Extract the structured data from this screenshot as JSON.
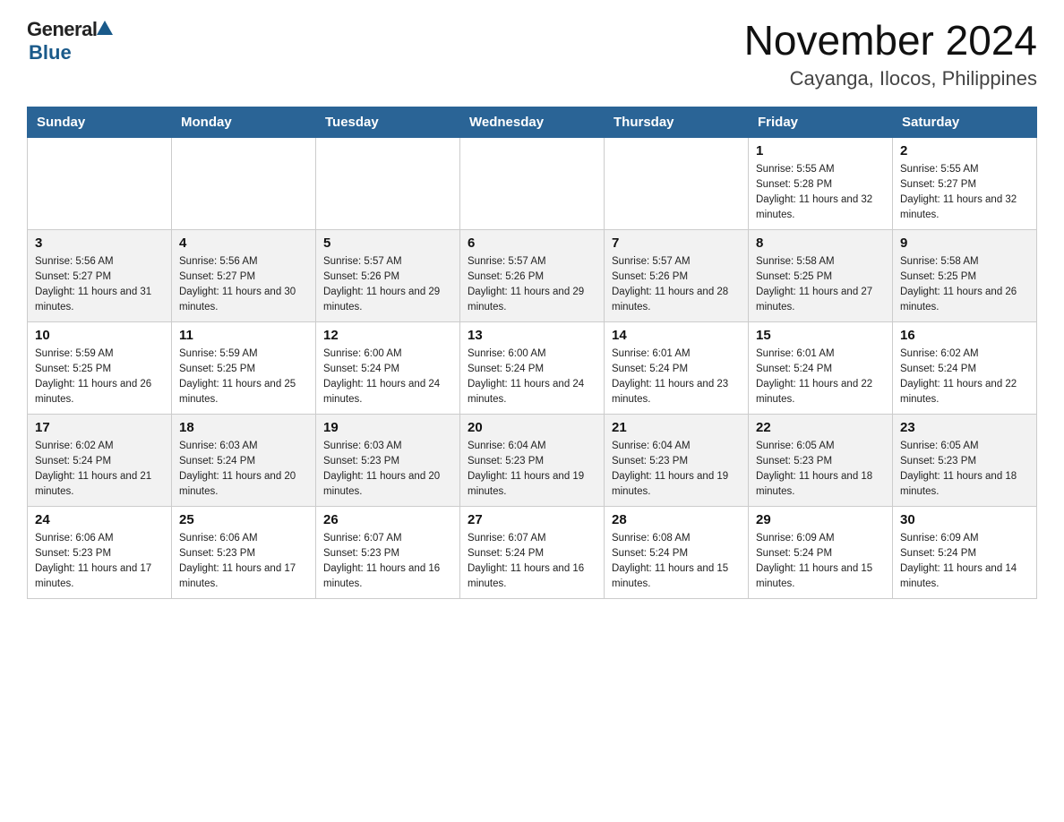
{
  "header": {
    "logo_general": "General",
    "logo_blue": "Blue",
    "month_year": "November 2024",
    "location": "Cayanga, Ilocos, Philippines"
  },
  "weekdays": [
    "Sunday",
    "Monday",
    "Tuesday",
    "Wednesday",
    "Thursday",
    "Friday",
    "Saturday"
  ],
  "weeks": [
    [
      {
        "day": "",
        "info": ""
      },
      {
        "day": "",
        "info": ""
      },
      {
        "day": "",
        "info": ""
      },
      {
        "day": "",
        "info": ""
      },
      {
        "day": "",
        "info": ""
      },
      {
        "day": "1",
        "info": "Sunrise: 5:55 AM\nSunset: 5:28 PM\nDaylight: 11 hours and 32 minutes."
      },
      {
        "day": "2",
        "info": "Sunrise: 5:55 AM\nSunset: 5:27 PM\nDaylight: 11 hours and 32 minutes."
      }
    ],
    [
      {
        "day": "3",
        "info": "Sunrise: 5:56 AM\nSunset: 5:27 PM\nDaylight: 11 hours and 31 minutes."
      },
      {
        "day": "4",
        "info": "Sunrise: 5:56 AM\nSunset: 5:27 PM\nDaylight: 11 hours and 30 minutes."
      },
      {
        "day": "5",
        "info": "Sunrise: 5:57 AM\nSunset: 5:26 PM\nDaylight: 11 hours and 29 minutes."
      },
      {
        "day": "6",
        "info": "Sunrise: 5:57 AM\nSunset: 5:26 PM\nDaylight: 11 hours and 29 minutes."
      },
      {
        "day": "7",
        "info": "Sunrise: 5:57 AM\nSunset: 5:26 PM\nDaylight: 11 hours and 28 minutes."
      },
      {
        "day": "8",
        "info": "Sunrise: 5:58 AM\nSunset: 5:25 PM\nDaylight: 11 hours and 27 minutes."
      },
      {
        "day": "9",
        "info": "Sunrise: 5:58 AM\nSunset: 5:25 PM\nDaylight: 11 hours and 26 minutes."
      }
    ],
    [
      {
        "day": "10",
        "info": "Sunrise: 5:59 AM\nSunset: 5:25 PM\nDaylight: 11 hours and 26 minutes."
      },
      {
        "day": "11",
        "info": "Sunrise: 5:59 AM\nSunset: 5:25 PM\nDaylight: 11 hours and 25 minutes."
      },
      {
        "day": "12",
        "info": "Sunrise: 6:00 AM\nSunset: 5:24 PM\nDaylight: 11 hours and 24 minutes."
      },
      {
        "day": "13",
        "info": "Sunrise: 6:00 AM\nSunset: 5:24 PM\nDaylight: 11 hours and 24 minutes."
      },
      {
        "day": "14",
        "info": "Sunrise: 6:01 AM\nSunset: 5:24 PM\nDaylight: 11 hours and 23 minutes."
      },
      {
        "day": "15",
        "info": "Sunrise: 6:01 AM\nSunset: 5:24 PM\nDaylight: 11 hours and 22 minutes."
      },
      {
        "day": "16",
        "info": "Sunrise: 6:02 AM\nSunset: 5:24 PM\nDaylight: 11 hours and 22 minutes."
      }
    ],
    [
      {
        "day": "17",
        "info": "Sunrise: 6:02 AM\nSunset: 5:24 PM\nDaylight: 11 hours and 21 minutes."
      },
      {
        "day": "18",
        "info": "Sunrise: 6:03 AM\nSunset: 5:24 PM\nDaylight: 11 hours and 20 minutes."
      },
      {
        "day": "19",
        "info": "Sunrise: 6:03 AM\nSunset: 5:23 PM\nDaylight: 11 hours and 20 minutes."
      },
      {
        "day": "20",
        "info": "Sunrise: 6:04 AM\nSunset: 5:23 PM\nDaylight: 11 hours and 19 minutes."
      },
      {
        "day": "21",
        "info": "Sunrise: 6:04 AM\nSunset: 5:23 PM\nDaylight: 11 hours and 19 minutes."
      },
      {
        "day": "22",
        "info": "Sunrise: 6:05 AM\nSunset: 5:23 PM\nDaylight: 11 hours and 18 minutes."
      },
      {
        "day": "23",
        "info": "Sunrise: 6:05 AM\nSunset: 5:23 PM\nDaylight: 11 hours and 18 minutes."
      }
    ],
    [
      {
        "day": "24",
        "info": "Sunrise: 6:06 AM\nSunset: 5:23 PM\nDaylight: 11 hours and 17 minutes."
      },
      {
        "day": "25",
        "info": "Sunrise: 6:06 AM\nSunset: 5:23 PM\nDaylight: 11 hours and 17 minutes."
      },
      {
        "day": "26",
        "info": "Sunrise: 6:07 AM\nSunset: 5:23 PM\nDaylight: 11 hours and 16 minutes."
      },
      {
        "day": "27",
        "info": "Sunrise: 6:07 AM\nSunset: 5:24 PM\nDaylight: 11 hours and 16 minutes."
      },
      {
        "day": "28",
        "info": "Sunrise: 6:08 AM\nSunset: 5:24 PM\nDaylight: 11 hours and 15 minutes."
      },
      {
        "day": "29",
        "info": "Sunrise: 6:09 AM\nSunset: 5:24 PM\nDaylight: 11 hours and 15 minutes."
      },
      {
        "day": "30",
        "info": "Sunrise: 6:09 AM\nSunset: 5:24 PM\nDaylight: 11 hours and 14 minutes."
      }
    ]
  ]
}
